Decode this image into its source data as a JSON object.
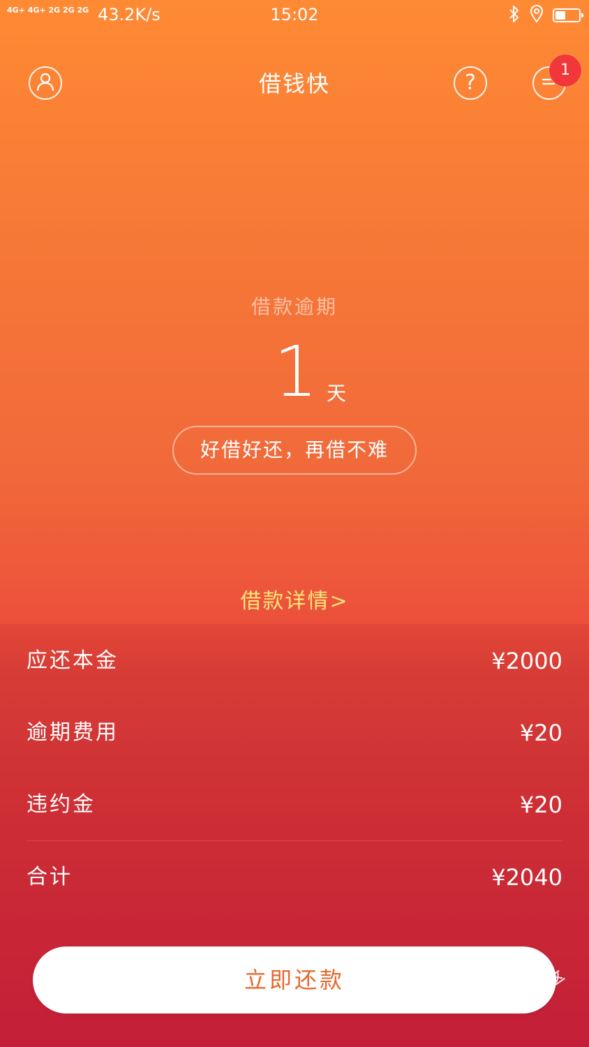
{
  "status_bar": {
    "network": "4G+ 4G+ 2G 2G 2G",
    "speed": "43.2K/s",
    "time": "15:02",
    "bluetooth_icon": "bluetooth-icon",
    "location_icon": "location-icon",
    "battery_level": 0.45
  },
  "header": {
    "title": "借钱快",
    "profile_icon": "user-icon",
    "help_icon": "help-icon",
    "menu_icon": "message-icon",
    "badge_count": "1"
  },
  "overdue": {
    "label": "借款逾期",
    "days": "1",
    "unit": "天",
    "slogan": "好借好还，再借不难"
  },
  "detail_link": "借款详情>",
  "bill": {
    "rows": [
      {
        "label": "应还本金",
        "value": "¥2000"
      },
      {
        "label": "逾期费用",
        "value": "¥20"
      },
      {
        "label": "违约金",
        "value": "¥20"
      },
      {
        "label": "合计",
        "value": "¥2040"
      }
    ]
  },
  "repay_button": "立即还款",
  "watermark": "卡农社区",
  "colors": {
    "gradient_top": "#ff8a34",
    "gradient_bottom": "#c9233d",
    "badge": "#f2373a",
    "detail_link": "#ffe77a",
    "button_text": "#e8672b"
  }
}
